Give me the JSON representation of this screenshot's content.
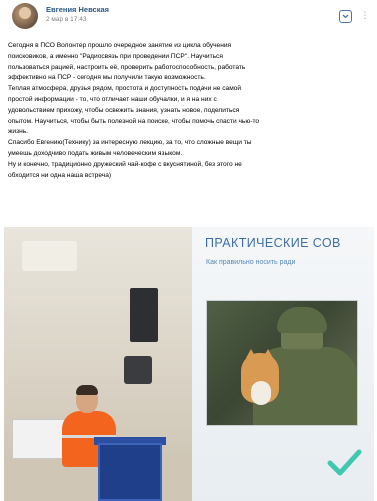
{
  "post": {
    "author": "Евгения Невская",
    "date": "2 мар в 17:43",
    "text_lines": [
      "Сегодня в ПСО Волонтер прошло очередное занятие из цикла обучения",
      "поисковиков, а именно \"Радиосвязь при проведении ПСР\". Научиться",
      "пользоваться рацией, настроить её, проверить работоспособность, работать",
      "эффективно на ПСР - сегодня мы получили такую возможность.",
      "Теплая атмосфера, друзья рядом, простота и доступность подачи не самой",
      "простой информации - то, что отличает наши обучалки, и я на них с",
      "удовольствием прихожу, чтобы освежить знания, узнать новое, поделиться",
      "опытом. Научиться, чтобы быть полезной на поиске, чтобы помочь спасти чью-то",
      "жизнь.",
      "Спасибо Евгению(Технику) за интересную лекцию, за то, что сложные вещи ты",
      "умеешь доходчиво подать живым человеческим языком.",
      "Ну и конечно, традиционно дружеский чай-кофе с вкуснятиной, без этого не",
      "обходится ни одна наша встреча)"
    ]
  },
  "photo": {
    "slide_title": "ПРАКТИЧЕСКИЕ СОВ",
    "slide_subtitle": "Как правильно носить ради"
  },
  "icons": {
    "bookmark": "bookmark-icon",
    "more": "more-icon",
    "checkmark": "checkmark-icon"
  },
  "colors": {
    "author_link": "#2a5885",
    "slide_title": "#3d6fa5",
    "checkmark": "#3fc7b0",
    "vest": "#f3651f"
  }
}
